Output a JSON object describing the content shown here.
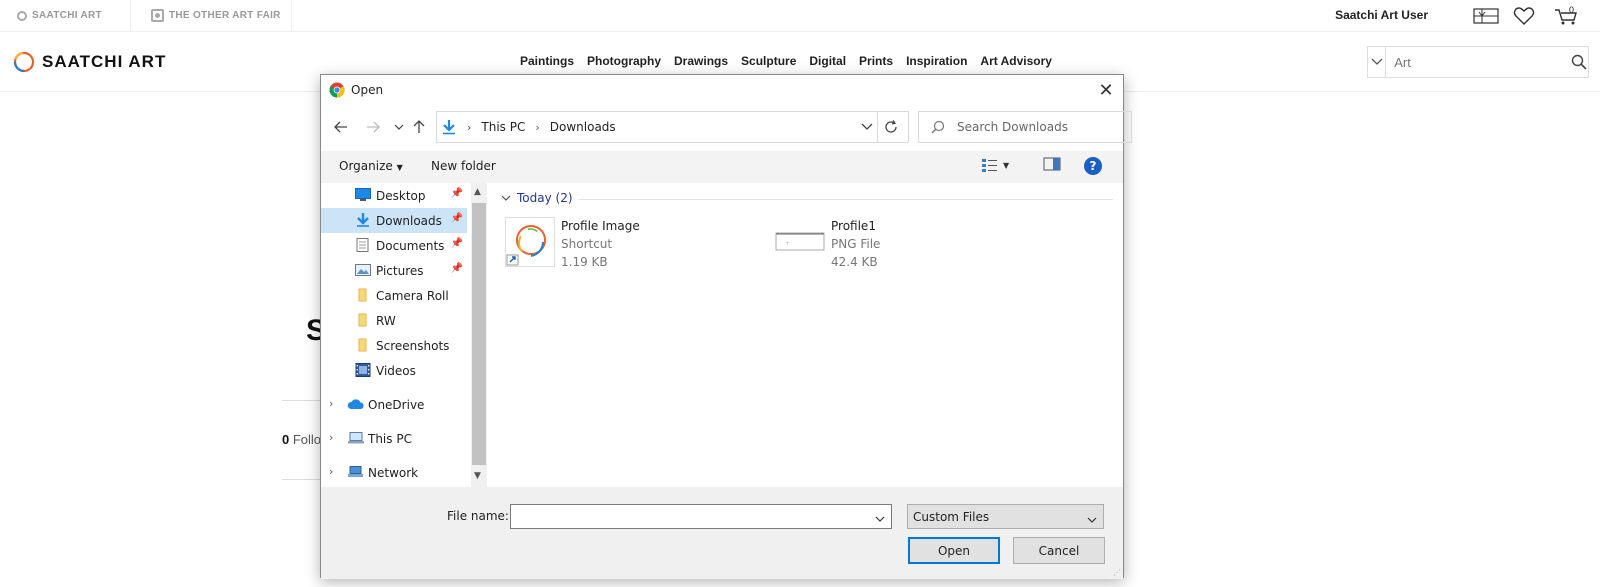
{
  "site": {
    "topbar": {
      "brand1": "SAATCHI ART",
      "brand2": "THE OTHER ART FAIR",
      "user": "Saatchi Art User",
      "cart_count": "0"
    },
    "logo": "SAATCHI ART",
    "nav": [
      "Paintings",
      "Photography",
      "Drawings",
      "Sculpture",
      "Digital",
      "Prints",
      "Inspiration",
      "Art Advisory"
    ],
    "search": {
      "placeholder": "Art"
    },
    "background": {
      "heading_fragment": "S",
      "follow_count": "0",
      "follow_label": "Follo"
    }
  },
  "dialog": {
    "title": "Open",
    "path": [
      "This PC",
      "Downloads"
    ],
    "search_placeholder": "Search Downloads",
    "toolbar": {
      "organize": "Organize",
      "new_folder": "New folder",
      "help": "?"
    },
    "nav_pane": {
      "quick_access": [
        {
          "label": "Desktop",
          "pinned": true
        },
        {
          "label": "Downloads",
          "pinned": true,
          "selected": true
        },
        {
          "label": "Documents",
          "pinned": true
        },
        {
          "label": "Pictures",
          "pinned": true
        },
        {
          "label": "Camera Roll"
        },
        {
          "label": "RW"
        },
        {
          "label": "Screenshots"
        },
        {
          "label": "Videos"
        }
      ],
      "groups": [
        "OneDrive",
        "This PC",
        "Network"
      ]
    },
    "group_header": "Today (2)",
    "files": [
      {
        "name": "Profile Image",
        "type": "Shortcut",
        "size": "1.19 KB"
      },
      {
        "name": "Profile1",
        "type": "PNG File",
        "size": "42.4 KB"
      }
    ],
    "footer": {
      "file_name_label": "File name:",
      "file_name_value": "",
      "filter": "Custom Files",
      "open": "Open",
      "cancel": "Cancel"
    }
  },
  "colors": {
    "accent": "#0078d7",
    "selection": "#cce4f7",
    "help": "#1a5fc2"
  }
}
